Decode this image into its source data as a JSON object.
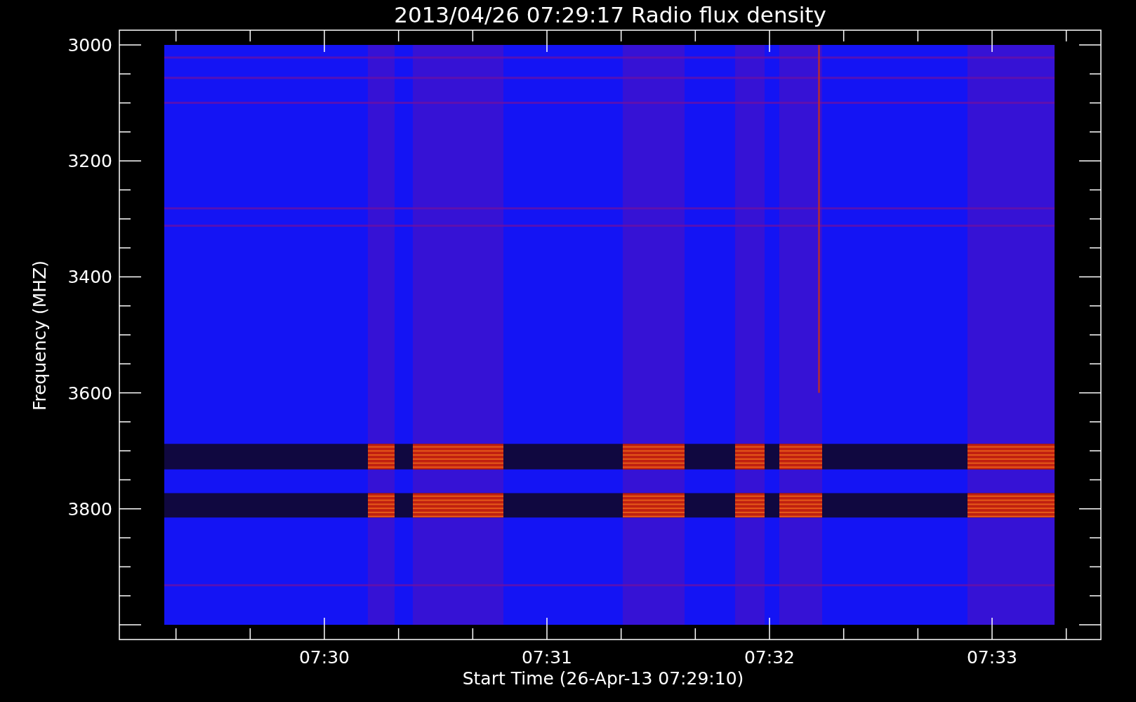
{
  "title": "2013/04/26 07:29:17 Radio flux density",
  "y_axis": {
    "label": "Frequency (MHZ)",
    "ticks": [
      "3000",
      "3200",
      "3400",
      "3600",
      "3800"
    ]
  },
  "x_axis": {
    "label": "Start Time (26-Apr-13 07:29:10)",
    "ticks": [
      "07:30",
      "07:31",
      "07:32",
      "07:33"
    ]
  }
}
